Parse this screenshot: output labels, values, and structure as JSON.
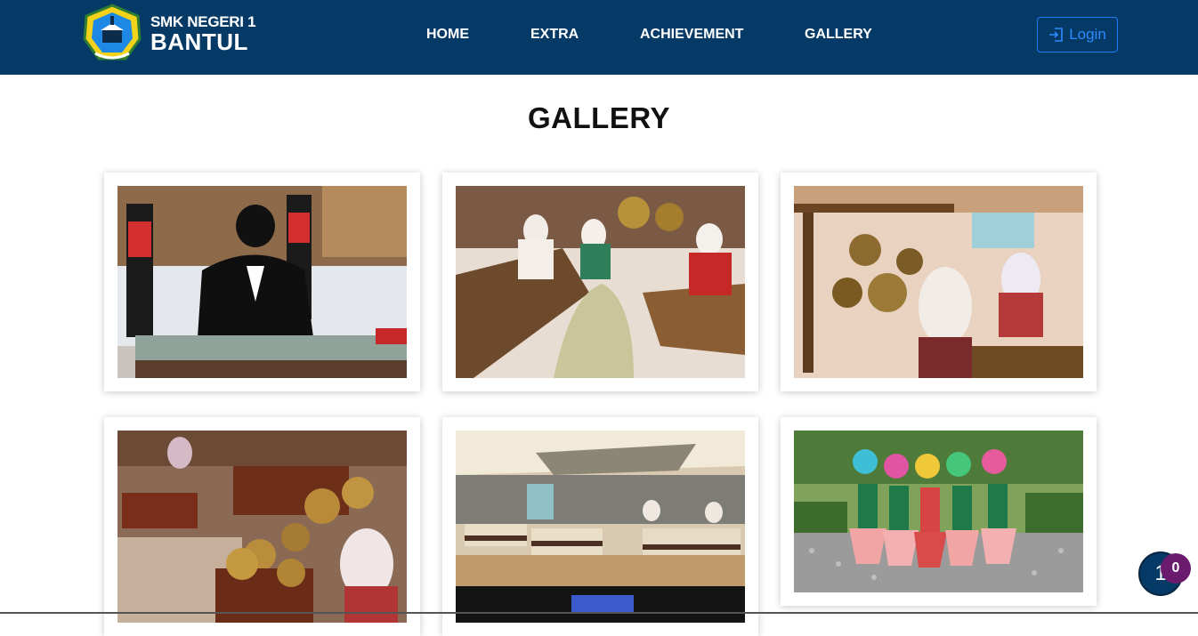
{
  "brand": {
    "line1": "SMK NEGERI 1",
    "line2": "BANTUL",
    "logo_icon": "school-crest-icon"
  },
  "nav": {
    "items": [
      {
        "label": "HOME"
      },
      {
        "label": "EXTRA"
      },
      {
        "label": "ACHIEVEMENT"
      },
      {
        "label": "GALLERY"
      }
    ]
  },
  "login": {
    "label": "Login",
    "icon": "login-arrow-icon"
  },
  "page": {
    "title": "GALLERY"
  },
  "gallery": {
    "items": [
      {
        "subject": "marching-band-glockenspiel-photo"
      },
      {
        "subject": "gamelan-practice-photo"
      },
      {
        "subject": "gamelan-gongs-photo"
      },
      {
        "subject": "gamelan-bonang-photo"
      },
      {
        "subject": "meeting-hall-photo"
      },
      {
        "subject": "traditional-dance-photo"
      }
    ]
  },
  "chat_widget": {
    "count": "0",
    "glyph": "1"
  },
  "colors": {
    "navbar": "#063a66",
    "login_accent": "#1e7bff",
    "badge": "#6a1b6e"
  }
}
